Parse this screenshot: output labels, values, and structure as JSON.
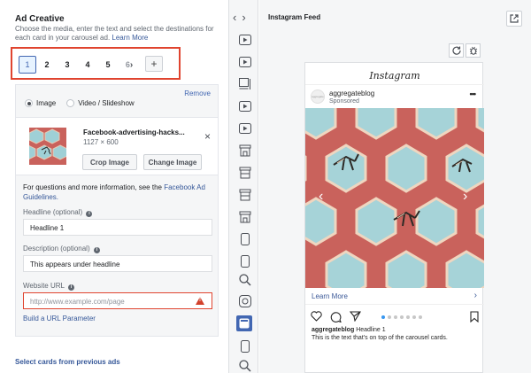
{
  "editor": {
    "title": "Ad Creative",
    "subtitle": "Choose the media, enter the text and select the destinations for each card in your carousel ad.",
    "learn_more": "Learn More",
    "card_tabs": [
      "1",
      "2",
      "3",
      "4",
      "5",
      "6"
    ],
    "add_card": "+",
    "remove": "Remove",
    "media_options": [
      "Image",
      "Video / Slideshow"
    ],
    "media": {
      "file_name": "Facebook-advertising-hacks...",
      "dimensions": "1127 × 600",
      "crop_button": "Crop Image",
      "change_button": "Change Image",
      "remove_icon": "×"
    },
    "help_text": "For questions and more information, see the",
    "help_link": "Facebook Ad Guidelines.",
    "headline": {
      "label": "Headline",
      "optional": "(optional)",
      "value": "Headline 1"
    },
    "description": {
      "label": "Description",
      "optional": "(optional)",
      "value": "This appears under headline"
    },
    "website_url": {
      "label": "Website URL",
      "placeholder": "http://www.example.com/page"
    },
    "build_url": "Build a URL Parameter",
    "select_previous": "Select cards from previous ads"
  },
  "preview": {
    "title": "Instagram Feed",
    "app_logo": "Instagram",
    "account": "aggregateblog",
    "sponsored": "Sponsored",
    "avatar_text": "aggregate",
    "more": "•••",
    "learn_more": "Learn More",
    "learn_more_chevron": "›",
    "caption_name": "aggregateblog",
    "caption_headline": "Headline 1",
    "caption_text": "This is the text that's on top of the carousel cards.",
    "carousel_dots": 7,
    "active_dot": 0
  },
  "nav": {
    "prev": "‹",
    "next": "›"
  },
  "colors": {
    "accent": "#4267b2",
    "error": "#e0442f",
    "link": "#365899",
    "image_bg": "#c9625c"
  }
}
